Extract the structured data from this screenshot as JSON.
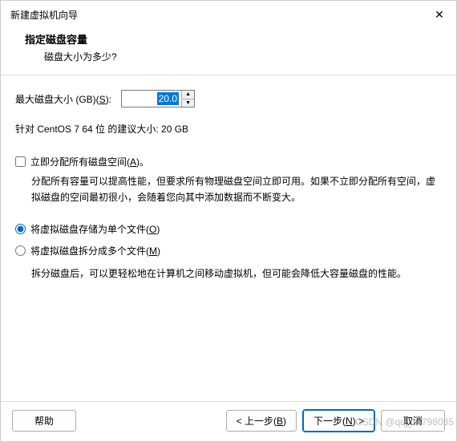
{
  "titlebar": {
    "title": "新建虚拟机向导"
  },
  "header": {
    "title": "指定磁盘容量",
    "subtitle": "磁盘大小为多少?"
  },
  "disk": {
    "label_prefix": "最大磁盘大小 (GB)(",
    "label_hotkey": "S",
    "label_suffix": "):",
    "value": "20.0",
    "recommendation": "针对 CentOS 7 64 位 的建议大小: 20 GB"
  },
  "allocate": {
    "label_prefix": "立即分配所有磁盘空间(",
    "label_hotkey": "A",
    "label_suffix": ")。",
    "desc": "分配所有容量可以提高性能，但要求所有物理磁盘空间立即可用。如果不立即分配所有空间，虚拟磁盘的空间最初很小，会随着您向其中添加数据而不断变大。",
    "checked": false
  },
  "storage": {
    "single_prefix": "将虚拟磁盘存储为单个文件(",
    "single_hotkey": "O",
    "single_suffix": ")",
    "split_prefix": "将虚拟磁盘拆分成多个文件(",
    "split_hotkey": "M",
    "split_suffix": ")",
    "split_desc": "拆分磁盘后，可以更轻松地在计算机之间移动虚拟机，但可能会降低大容量磁盘的性能。",
    "selected": "single"
  },
  "footer": {
    "help": "帮助",
    "back_prefix": "< 上一步(",
    "back_hotkey": "B",
    "back_suffix": ")",
    "next_prefix": "下一步(",
    "next_hotkey": "N",
    "next_suffix": ") >",
    "cancel": "取消"
  },
  "watermark": "CSDN @qq_17798035"
}
